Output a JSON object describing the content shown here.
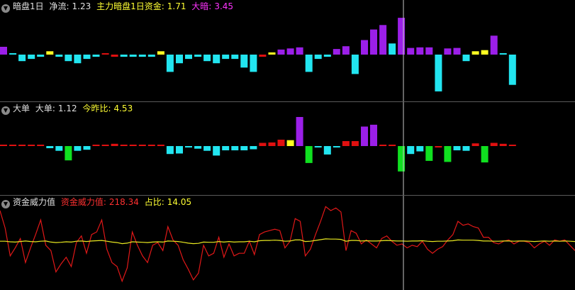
{
  "panels": [
    {
      "title": "暗盘1日",
      "indicators": [
        {
          "label": "净流:",
          "value": "1.23",
          "label_color": "#e0e0e0",
          "value_color": "#e0e0e0"
        },
        {
          "label": "主力暗盘1日资金:",
          "value": "1.71",
          "label_color": "#ffff33",
          "value_color": "#ffff33"
        },
        {
          "label": "大暗:",
          "value": "3.45",
          "label_color": "#ff33ff",
          "value_color": "#ff33ff"
        }
      ]
    },
    {
      "title": "大单",
      "indicators": [
        {
          "label": "大单:",
          "value": "1.12",
          "label_color": "#e0e0e0",
          "value_color": "#e0e0e0"
        },
        {
          "label": "今昨比:",
          "value": "4.53",
          "label_color": "#ffff33",
          "value_color": "#ffff33"
        }
      ]
    },
    {
      "title": "资金威力值",
      "indicators": [
        {
          "label": "资金威力值:",
          "value": "218.34",
          "label_color": "#ff3030",
          "value_color": "#ff3030"
        },
        {
          "label": "占比:",
          "value": "14.05",
          "label_color": "#ffff33",
          "value_color": "#ffff33"
        }
      ]
    }
  ],
  "colors": {
    "purple": "#9b1fe8",
    "cyan": "#22e5f0",
    "yellow": "#ffff22",
    "red": "#e01010",
    "green": "#10e020",
    "line_red": "#e01818",
    "line_yellow": "#e8e820",
    "crosshair": "#c8c8c8"
  },
  "chart_data": [
    {
      "type": "bar",
      "panel": "暗盘1日",
      "series": [
        {
          "values": [
            1.4,
            0.0,
            -0.3,
            -0.2,
            -0.1,
            0.6,
            -0.1,
            -0.3,
            -0.4,
            -0.2,
            -0.1,
            0.0,
            -0.1,
            -0.1,
            -0.1,
            -0.1,
            -0.1,
            0.6,
            -0.8,
            -0.4,
            -0.2,
            -0.1,
            -0.3,
            -0.4,
            -0.2,
            -0.2,
            -0.6,
            -0.8,
            -0.1,
            0.4,
            0.9,
            1.1,
            1.3,
            -0.8,
            -0.2,
            -0.1,
            1.0,
            1.5,
            -0.9,
            2.6,
            4.5,
            5.3,
            2.0,
            6.6,
            1.2,
            1.3,
            1.3,
            -1.7,
            1.1,
            1.2,
            -0.3,
            0.6,
            0.8,
            3.4,
            0.0,
            -1.4
          ],
          "colors": [
            "purple",
            "cyan",
            "cyan",
            "cyan",
            "cyan",
            "yellow",
            "cyan",
            "cyan",
            "cyan",
            "cyan",
            "cyan",
            "red",
            "red",
            "cyan",
            "cyan",
            "cyan",
            "cyan",
            "yellow",
            "cyan",
            "cyan",
            "cyan",
            "cyan",
            "cyan",
            "cyan",
            "cyan",
            "cyan",
            "cyan",
            "cyan",
            "red",
            "yellow",
            "purple",
            "purple",
            "purple",
            "cyan",
            "cyan",
            "cyan",
            "purple",
            "purple",
            "cyan",
            "purple",
            "purple",
            "purple",
            "cyan",
            "purple",
            "purple",
            "purple",
            "purple",
            "cyan",
            "purple",
            "purple",
            "cyan",
            "yellow",
            "yellow",
            "purple",
            "cyan",
            "cyan"
          ]
        }
      ],
      "ylim": [
        -2.0,
        7.5
      ]
    },
    {
      "type": "bar",
      "panel": "大单",
      "series": [
        {
          "values": [
            0.0,
            0.0,
            0.0,
            0.0,
            0.0,
            -0.4,
            -0.9,
            -2.7,
            -0.9,
            -0.7,
            0.0,
            0.3,
            0.5,
            0.0,
            0.0,
            0.0,
            0.0,
            0.0,
            -1.5,
            -1.4,
            -0.1,
            -0.5,
            -0.9,
            -1.8,
            -0.8,
            -0.8,
            -0.8,
            -0.6,
            0.7,
            0.8,
            1.4,
            1.3,
            6.4,
            -3.2,
            -0.2,
            -1.6,
            -0.1,
            1.1,
            1.1,
            4.3,
            4.7,
            0.0,
            0.0,
            -4.8,
            -1.5,
            -1.0,
            -2.8,
            -0.1,
            -3.0,
            -0.8,
            -0.9,
            0.6,
            -3.1,
            0.7,
            0.5,
            0.3
          ],
          "colors": [
            "red",
            "red",
            "red",
            "red",
            "red",
            "cyan",
            "cyan",
            "green",
            "cyan",
            "cyan",
            "red",
            "red",
            "red",
            "red",
            "red",
            "red",
            "red",
            "red",
            "cyan",
            "cyan",
            "cyan",
            "cyan",
            "cyan",
            "cyan",
            "cyan",
            "cyan",
            "cyan",
            "cyan",
            "red",
            "red",
            "red",
            "yellow",
            "purple",
            "green",
            "cyan",
            "cyan",
            "cyan",
            "red",
            "red",
            "purple",
            "purple",
            "red",
            "red",
            "green",
            "cyan",
            "cyan",
            "green",
            "red",
            "green",
            "cyan",
            "cyan",
            "red",
            "green",
            "red",
            "red",
            "red"
          ]
        }
      ],
      "ylim": [
        -7.5,
        7.5
      ]
    },
    {
      "type": "line",
      "panel": "资金威力值",
      "series": [
        {
          "color": "#e01818",
          "values": [
            290,
            225,
            120,
            150,
            185,
            95,
            150,
            200,
            255,
            160,
            140,
            60,
            90,
            115,
            80,
            170,
            195,
            130,
            200,
            210,
            255,
            145,
            95,
            80,
            25,
            75,
            210,
            160,
            120,
            95,
            160,
            170,
            140,
            230,
            180,
            160,
            105,
            70,
            30,
            55,
            160,
            120,
            130,
            190,
            115,
            165,
            120,
            130,
            130,
            175,
            125,
            200,
            210,
            215,
            220,
            215,
            150,
            175,
            260,
            250,
            120,
            145,
            200,
            250,
            305,
            290,
            300,
            285,
            140,
            215,
            205,
            165,
            180,
            165,
            150,
            185,
            195,
            175,
            160,
            165,
            150,
            160,
            155,
            175,
            145,
            130,
            145,
            155,
            180,
            200,
            250,
            235,
            240,
            230,
            225,
            190,
            190,
            170,
            165,
            175,
            180,
            165,
            175,
            175,
            170,
            150,
            165,
            175,
            160,
            180,
            175,
            180,
            160,
            140
          ]
        },
        {
          "color": "#e8e820",
          "values": [
            175,
            175,
            173,
            172,
            174,
            176,
            174,
            173,
            175,
            176,
            172,
            170,
            171,
            173,
            172,
            175,
            176,
            174,
            176,
            177,
            178,
            175,
            172,
            170,
            166,
            168,
            173,
            172,
            171,
            170,
            172,
            173,
            172,
            176,
            175,
            174,
            171,
            168,
            166,
            167,
            172,
            171,
            171,
            174,
            172,
            174,
            172,
            173,
            173,
            175,
            173,
            177,
            178,
            178,
            179,
            178,
            175,
            176,
            180,
            180,
            174,
            175,
            178,
            181,
            184,
            183,
            183,
            182,
            175,
            178,
            178,
            176,
            177,
            176,
            176,
            177,
            178,
            177,
            176,
            176,
            175,
            176,
            176,
            177,
            175,
            174,
            175,
            175,
            176,
            177,
            180,
            179,
            179,
            179,
            178,
            176,
            176,
            175,
            175,
            176,
            176,
            175,
            176,
            176,
            175,
            174,
            175,
            176,
            175,
            176,
            175,
            176,
            175,
            174
          ]
        }
      ],
      "ylim": [
        0,
        330
      ]
    }
  ]
}
